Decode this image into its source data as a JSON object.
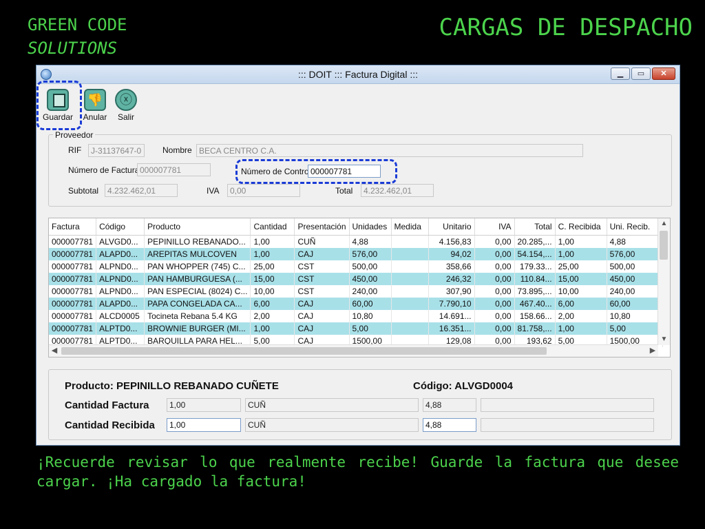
{
  "slide": {
    "brand_line1": "GREEN CODE",
    "brand_line2": "SOLUTIONS",
    "title": "CARGAS DE DESPACHO",
    "footer": "¡Recuerde revisar lo que realmente recibe! Guarde la factura que desee cargar. ¡Ha cargado la factura!"
  },
  "window": {
    "title": "::: DOIT ::: Factura Digital :::",
    "minimize": "▁",
    "maximize": "▭",
    "close": "✕"
  },
  "toolbar": {
    "guardar": "Guardar",
    "anular": "Anular",
    "salir": "Salir",
    "anular_icon": "👎",
    "salir_icon": "ⓧ"
  },
  "proveedor": {
    "legend": "Proveedor",
    "rif_label": "RIF",
    "rif_value": "J-31137647-0",
    "nombre_label": "Nombre",
    "nombre_value": "BECA CENTRO C.A.",
    "num_factura_label": "Número de Factura",
    "num_factura_value": "000007781",
    "num_control_label": "Número de Control",
    "num_control_value": "000007781",
    "subtotal_label": "Subtotal",
    "subtotal_value": "4.232.462,01",
    "iva_label": "IVA",
    "iva_value": "0,00",
    "total_label": "Total",
    "total_value": "4.232.462,01"
  },
  "grid": {
    "columns": [
      "Factura",
      "Código",
      "Producto",
      "Cantidad",
      "Presentación",
      "Unidades",
      "Medida",
      "Unitario",
      "IVA",
      "Total",
      "C. Recibida",
      "Uni. Recib."
    ],
    "rows": [
      [
        "000007781",
        "ALVGD0...",
        "PEPINILLO REBANADO...",
        "1,00",
        "CUÑ",
        "4,88",
        "",
        "4.156,83",
        "0,00",
        "20.285,...",
        "1,00",
        "4,88"
      ],
      [
        "000007781",
        "ALAPD0...",
        "AREPITAS MULCOVEN",
        "1,00",
        "CAJ",
        "576,00",
        "",
        "94,02",
        "0,00",
        "54.154,...",
        "1,00",
        "576,00"
      ],
      [
        "000007781",
        "ALPND0...",
        "PAN WHOPPER (745) C...",
        "25,00",
        "CST",
        "500,00",
        "",
        "358,66",
        "0,00",
        "179.33...",
        "25,00",
        "500,00"
      ],
      [
        "000007781",
        "ALPND0...",
        "PAN HAMBURGUESA (...",
        "15,00",
        "CST",
        "450,00",
        "",
        "246,32",
        "0,00",
        "110.84...",
        "15,00",
        "450,00"
      ],
      [
        "000007781",
        "ALPND0...",
        "PAN ESPECIAL (8024) C...",
        "10,00",
        "CST",
        "240,00",
        "",
        "307,90",
        "0,00",
        "73.895,...",
        "10,00",
        "240,00"
      ],
      [
        "000007781",
        "ALAPD0...",
        "PAPA CONGELADA CA...",
        "6,00",
        "CAJ",
        "60,00",
        "",
        "7.790,10",
        "0,00",
        "467.40...",
        "6,00",
        "60,00"
      ],
      [
        "000007781",
        "ALCD0005",
        "Tocineta Rebana 5.4 KG",
        "2,00",
        "CAJ",
        "10,80",
        "",
        "14.691...",
        "0,00",
        "158.66...",
        "2,00",
        "10,80"
      ],
      [
        "000007781",
        "ALPTD0...",
        "BROWNIE BURGER (MI...",
        "1,00",
        "CAJ",
        "5,00",
        "",
        "16.351...",
        "0,00",
        "81.758,...",
        "1,00",
        "5,00"
      ],
      [
        "000007781",
        "ALPTD0...",
        "BARQUILLA PARA HEL...",
        "5,00",
        "CAJ",
        "1500,00",
        "",
        "129,08",
        "0,00",
        "193,62",
        "5,00",
        "1500,00"
      ]
    ]
  },
  "detalle": {
    "producto_label": "Producto: PEPINILLO REBANADO CUÑETE",
    "codigo_label": "Código: ALVGD0004",
    "cant_factura_label": "Cantidad Factura",
    "cant_factura_value": "1,00",
    "cant_factura_pres": "CUÑ",
    "cant_factura_unid": "4,88",
    "cant_recibida_label": "Cantidad Recibida",
    "cant_recibida_value": "1,00",
    "cant_recibida_pres": "CUÑ",
    "cant_recibida_unid": "4,88"
  }
}
